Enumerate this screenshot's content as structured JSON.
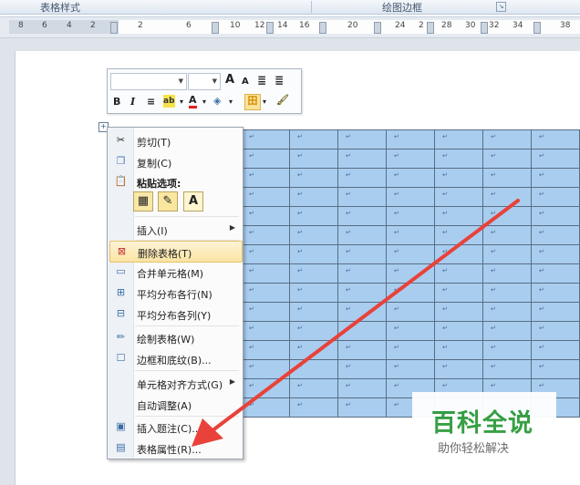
{
  "ribbon": {
    "group_table_styles": "表格样式",
    "group_draw_borders": "绘图边框"
  },
  "ruler": {
    "ticks": [
      "8",
      "6",
      "4",
      "2",
      "2",
      "6",
      "10",
      "12",
      "14",
      "16",
      "20",
      "24",
      "2",
      "28",
      "30",
      "32",
      "34",
      "38"
    ]
  },
  "mini_toolbar": {
    "font_value": "",
    "size_value": "",
    "grow_font": "A",
    "shrink_font": "A",
    "bold": "B",
    "italic": "I",
    "font_color_label": "A"
  },
  "context_menu": {
    "cut": "剪切(T)",
    "copy": "复制(C)",
    "paste_options": "粘贴选项:",
    "insert": "插入(I)",
    "delete_table": "删除表格(T)",
    "merge_cells": "合并单元格(M)",
    "distribute_rows": "平均分布各行(N)",
    "distribute_columns": "平均分布各列(Y)",
    "draw_table": "绘制表格(W)",
    "borders_shading": "边框和底纹(B)...",
    "cell_alignment": "单元格对齐方式(G)",
    "autofit": "自动调整(A)",
    "insert_caption": "插入题注(C)...",
    "table_properties": "表格属性(R)...",
    "paste_keep_text_letter": "A"
  },
  "table": {
    "cell_mark": "↵",
    "rows": 15,
    "cols": 7
  },
  "watermark": {
    "brand": "百科全说",
    "slogan": "助你轻松解决"
  },
  "colors": {
    "cell_fill": "#a8cdef",
    "highlight": "#fbe4a4",
    "arrow": "#e8423a",
    "brand_green": "#2d9b3a"
  }
}
